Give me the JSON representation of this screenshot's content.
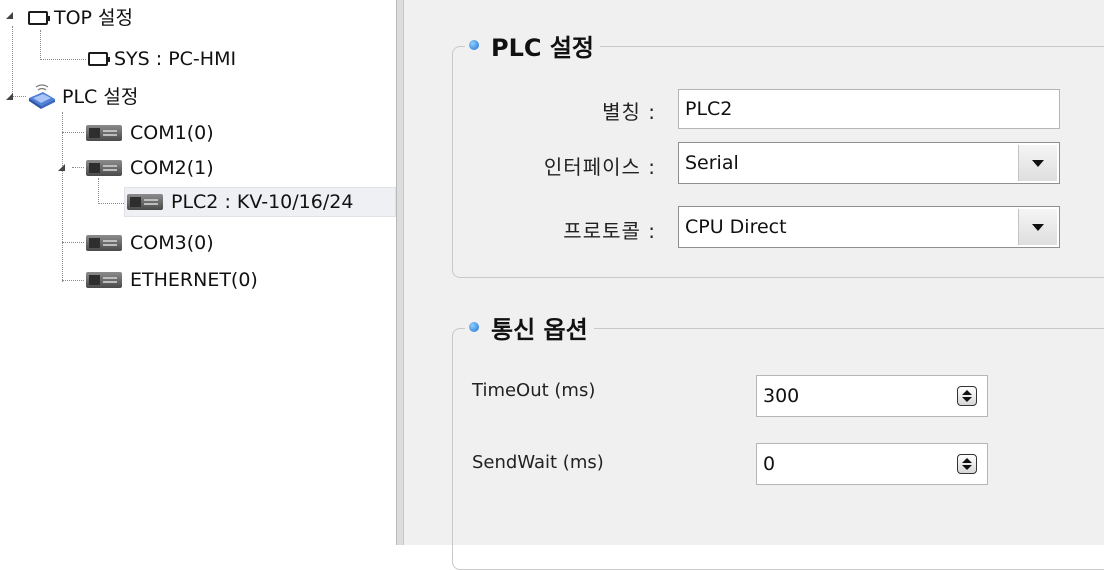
{
  "tree": {
    "nodes": [
      {
        "label": "TOP 설정",
        "icon": "monitor-icon"
      },
      {
        "label": "SYS : PC-HMI",
        "icon": "monitor-icon"
      },
      {
        "label": "PLC 설정",
        "icon": "plc-network-icon"
      },
      {
        "label": "COM1(0)",
        "icon": "com-port-icon"
      },
      {
        "label": "COM2(1)",
        "icon": "com-port-icon"
      },
      {
        "label": "PLC2 : KV-10/16/24",
        "icon": "com-port-icon",
        "selected": true
      },
      {
        "label": "COM3(0)",
        "icon": "com-port-icon"
      },
      {
        "label": "ETHERNET(0)",
        "icon": "com-port-icon"
      }
    ]
  },
  "plc_settings": {
    "title": "PLC 설정",
    "alias_label": "별칭 :",
    "alias_value": "PLC2",
    "interface_label": "인터페이스 :",
    "interface_value": "Serial",
    "protocol_label": "프로토콜 :",
    "protocol_value": "CPU Direct"
  },
  "comm_options": {
    "title": "통신 옵션",
    "timeout_label": "TimeOut (ms)",
    "timeout_value": "300",
    "sendwait_label": "SendWait (ms)",
    "sendwait_value": "0"
  },
  "colors": {
    "panel_bg": "#f0f0f0",
    "legend_dot": "#1f6fd0",
    "selected_row": "#eef0f3"
  }
}
